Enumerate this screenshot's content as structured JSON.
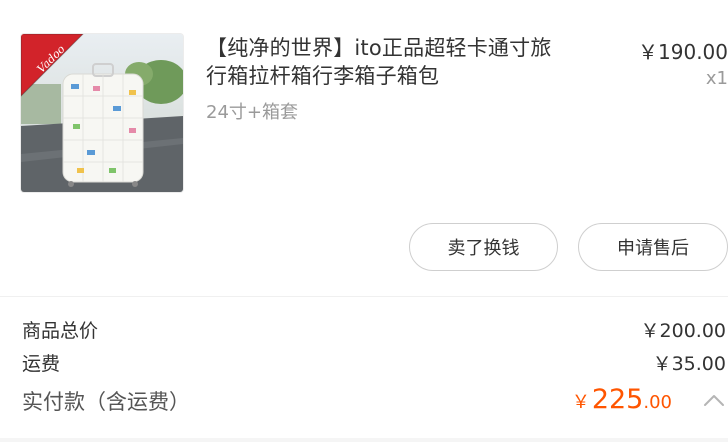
{
  "product": {
    "image_name": "suitcase-photo",
    "badge_text": "Vadoo",
    "title_line1": "【纯净的世界】ito正品超轻卡通寸旅",
    "title_line2": "行箱拉杆箱行李箱子箱包",
    "spec": "24寸+箱套",
    "unit_price": "￥190.00",
    "quantity": "x1"
  },
  "actions": {
    "resell_label": "卖了换钱",
    "aftersale_label": "申请售后"
  },
  "summary": {
    "goods_total_label": "商品总价",
    "goods_total_value": "￥200.00",
    "shipping_label": "运费",
    "shipping_value": "￥35.00",
    "paid_label": "实付款（含运费）",
    "paid_currency": "￥",
    "paid_integer": "225",
    "paid_decimal": ".00",
    "collapse_icon": "chevron-up-icon"
  },
  "colors": {
    "accent": "#ff5500",
    "badge": "#d2232a",
    "text": "#333333",
    "muted": "#9a9a9a"
  }
}
